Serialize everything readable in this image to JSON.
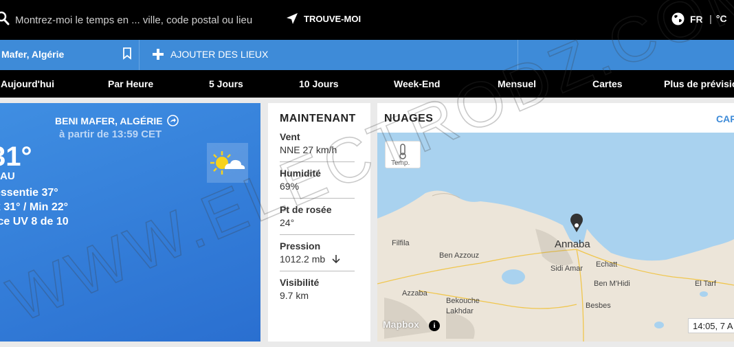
{
  "search": {
    "placeholder": "Montrez-moi le temps en ... ville, code postal ou lieu"
  },
  "locate_label": "TROUVE-MOI",
  "language": "FR",
  "unit": "°C",
  "location_bar": {
    "current": "Mafer, Algérie",
    "add_label": "AJOUTER DES LIEUX"
  },
  "nav": [
    "Aujourd'hui",
    "Par Heure",
    "5 Jours",
    "10 Jours",
    "Week-End",
    "Mensuel",
    "Cartes",
    "Plus de prévisio"
  ],
  "current": {
    "place": "BENI MAFER, ALGÉRIE",
    "since": "à partir de 13:59 CET",
    "temp": "31°",
    "condition": "AU",
    "feels_like": "essentie 37°",
    "minmax": "x 31° / Min 22°",
    "uv": "ice UV 8 de 10"
  },
  "now": {
    "title": "MAINTENANT",
    "items": [
      {
        "label": "Vent",
        "value": "NNE 27 km/h"
      },
      {
        "label": "Humidité",
        "value": "69%"
      },
      {
        "label": "Pt de rosée",
        "value": "24°"
      },
      {
        "label": "Pression",
        "value": "1012.2 mb"
      },
      {
        "label": "Visibilité",
        "value": "9.7 km"
      }
    ]
  },
  "clouds": {
    "title": "NUAGES",
    "link": "CAR",
    "temp_button": "Temp.",
    "attribution": "Mapbox",
    "timestamp": "14:05, 7 A",
    "labels": [
      "Annaba",
      "Filfila",
      "Ben Azzouz",
      "Sidi Amar",
      "Echatt",
      "Ben M'Hidi",
      "El Tarf",
      "Azzaba",
      "Bekouche Lakhdar",
      "Besbes"
    ]
  },
  "colors": {
    "brand_blue": "#3e8bd8",
    "topbar": "#000000"
  },
  "watermark": "WWW.ELECTRODZ.COM"
}
